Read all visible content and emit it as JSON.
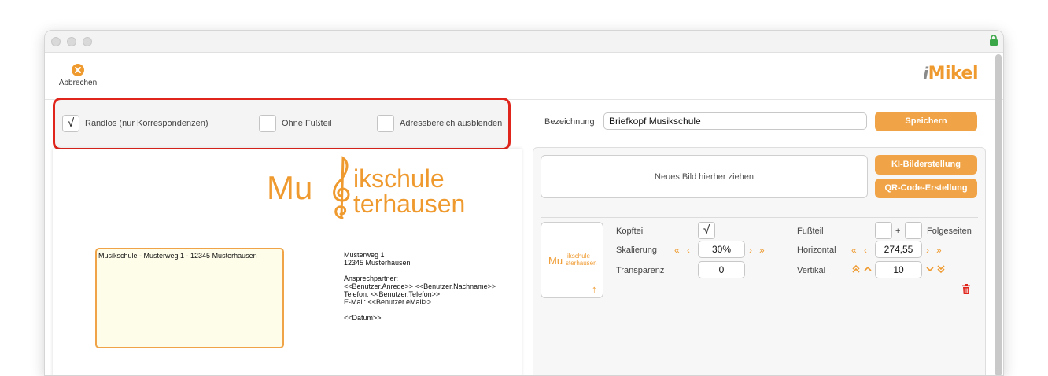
{
  "toolbar": {
    "cancel_label": "Abbrechen",
    "logo_prefix": "i",
    "logo_text": "Mikel"
  },
  "options": {
    "randlos_label": "Randlos (nur Korrespondenzen)",
    "randlos_check": "√",
    "ohne_fussteil_label": "Ohne Fußteil",
    "adressbereich_label": "Adressbereich ausblenden"
  },
  "form": {
    "bezeichnung_label": "Bezeichnung",
    "bezeichnung_value": "Briefkopf Musikschule",
    "save_label": "Speichern"
  },
  "image": {
    "dropzone_text": "Neues Bild hierher ziehen",
    "ki_button": "KI-Bilderstellung",
    "qr_button": "QR-Code-Erstellung"
  },
  "settings": {
    "kopfteil_label": "Kopfteil",
    "kopfteil_check": "√",
    "skalierung_label": "Skalierung",
    "skalierung_value": "30%",
    "transparenz_label": "Transparenz",
    "transparenz_value": "0",
    "fussteil_label": "Fußteil",
    "plus": "+",
    "folgeseiten_label": "Folgeseiten",
    "horizontal_label": "Horizontal",
    "horizontal_value": "274,55",
    "vertikal_label": "Vertikal",
    "vertikal_value": "10"
  },
  "preview": {
    "logo_line1": "ikschule",
    "logo_line2": "terhausen",
    "logo_left": "Mu",
    "sender_line": "Musikschule - Musterweg 1 - 12345 Musterhausen",
    "address_lines": [
      "Musterweg 1",
      "12345 Musterhausen"
    ],
    "contact_lines": [
      "Ansprechpartner:",
      "<<Benutzer.Anrede>> <<Benutzer.Nachname>>",
      "Telefon: <<Benutzer.Telefon>>",
      "E-Mail: <<Benutzer.eMail>>"
    ],
    "date_line": "<<Datum>>"
  },
  "thumb": {
    "left": "Mu",
    "line1": "ikschule",
    "line2": "sterhausen"
  },
  "colors": {
    "accent": "#f0a447",
    "highlight": "#e0251c",
    "address_bg": "#fefde9"
  }
}
